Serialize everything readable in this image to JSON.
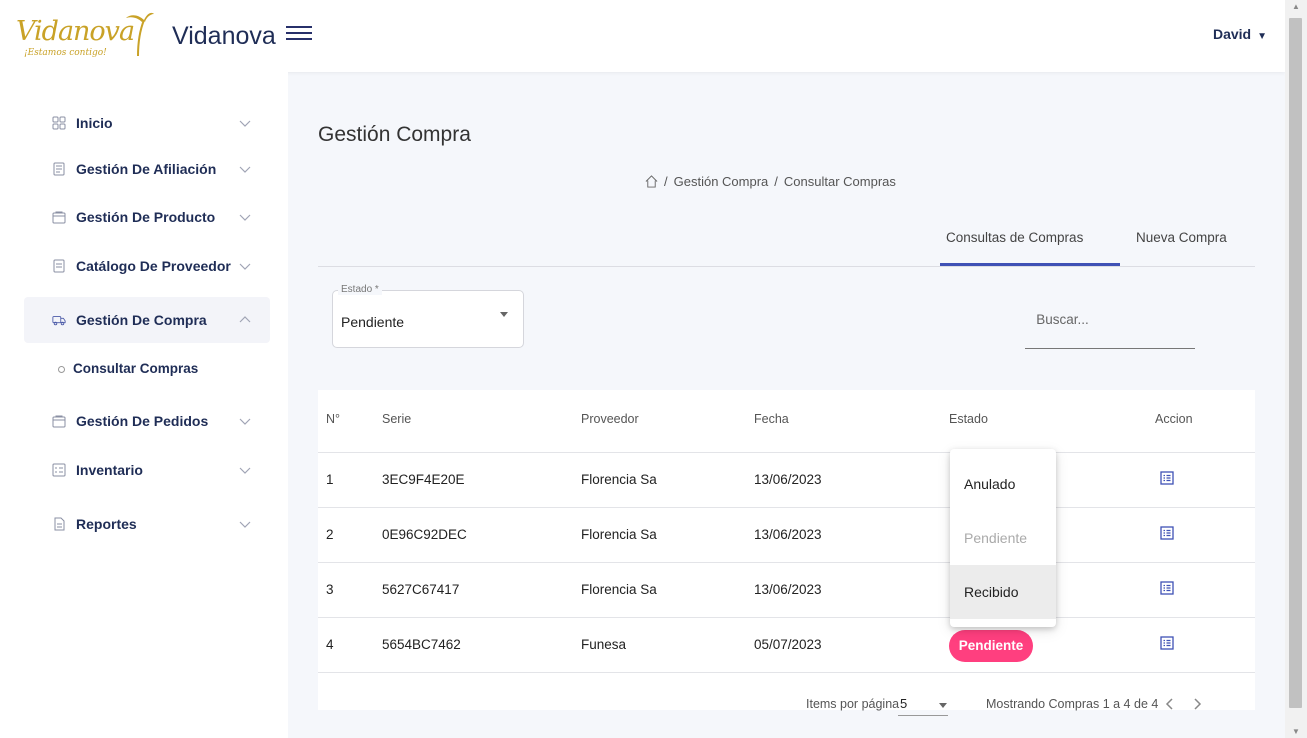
{
  "brand": {
    "logo_text": "Vidanova",
    "logo_tagline": "¡Estamos contigo!",
    "name": "Vidanova",
    "gold": "#c9a227"
  },
  "user": {
    "name": "David"
  },
  "sidebar": {
    "items": [
      {
        "label": "Inicio",
        "icon": "grid-icon"
      },
      {
        "label": "Gestión De Afiliación",
        "icon": "document-icon"
      },
      {
        "label": "Gestión De Producto",
        "icon": "bag-icon"
      },
      {
        "label": "Catálogo De Proveedor",
        "icon": "catalog-icon"
      },
      {
        "label": "Gestión De Compra",
        "icon": "truck-icon",
        "expanded": true
      },
      {
        "label": "Gestión De Pedidos",
        "icon": "bag-icon"
      },
      {
        "label": "Inventario",
        "icon": "list-icon"
      },
      {
        "label": "Reportes",
        "icon": "file-icon"
      }
    ],
    "subitem": "Consultar Compras"
  },
  "page": {
    "title": "Gestión Compra",
    "breadcrumb": [
      "Gestión Compra",
      "Consultar Compras"
    ]
  },
  "tabs": {
    "consultas": "Consultas de Compras",
    "nueva": "Nueva Compra"
  },
  "filter": {
    "estado_label": "Estado *",
    "estado_value": "Pendiente",
    "search_placeholder": "Buscar..."
  },
  "table": {
    "headers": [
      "N°",
      "Serie",
      "Proveedor",
      "Fecha",
      "Estado",
      "Accion"
    ],
    "rows": [
      {
        "n": "1",
        "serie": "3EC9F4E20E",
        "proveedor": "Florencia Sa",
        "fecha": "13/06/2023"
      },
      {
        "n": "2",
        "serie": "0E96C92DEC",
        "proveedor": "Florencia Sa",
        "fecha": "13/06/2023"
      },
      {
        "n": "3",
        "serie": "5627C67417",
        "proveedor": "Florencia Sa",
        "fecha": "13/06/2023"
      },
      {
        "n": "4",
        "serie": "5654BC7462",
        "proveedor": "Funesa",
        "fecha": "05/07/2023",
        "estado": "Pendiente"
      }
    ]
  },
  "status_menu": {
    "options": [
      "Anulado",
      "Pendiente",
      "Recibido"
    ]
  },
  "paginator": {
    "items_label": "Items por página",
    "page_size": "5",
    "range": "Mostrando Compras 1 a 4 de 4"
  },
  "colors": {
    "accent": "#3f51b5",
    "badge": "#ff3f7f",
    "navy": "#1f2d56"
  }
}
